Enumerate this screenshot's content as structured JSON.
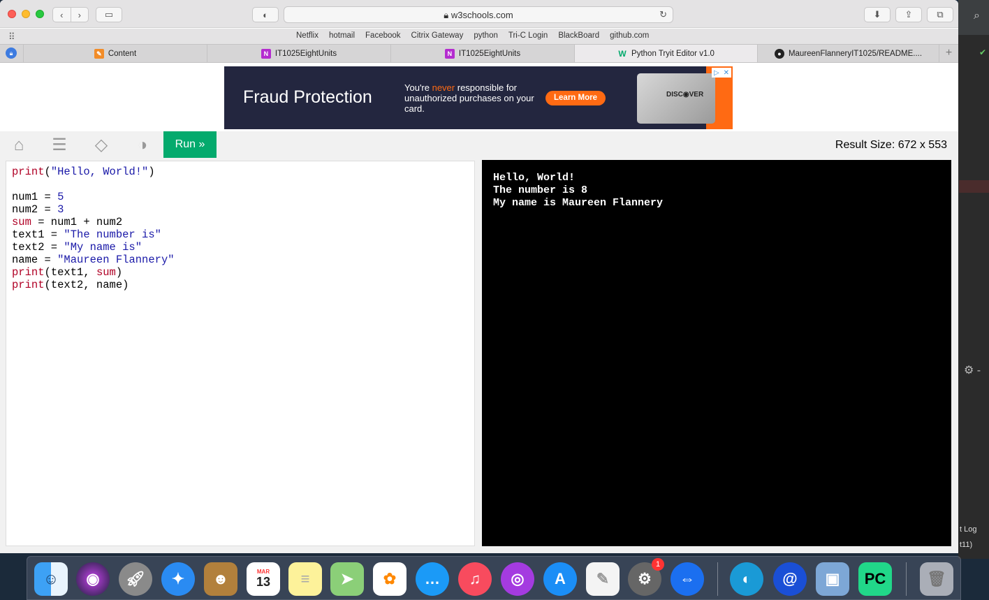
{
  "browser": {
    "url": "w3schools.com",
    "favorites": [
      "Netflix",
      "hotmail",
      "Facebook",
      "Citrix Gateway",
      "python",
      "Tri-C Login",
      "BlackBoard",
      "github.com"
    ],
    "tabs": [
      {
        "label": "Content",
        "icon": "content-icon"
      },
      {
        "label": "IT1025EightUnits",
        "icon": "onenote-icon"
      },
      {
        "label": "IT1025EightUnits",
        "icon": "onenote-icon"
      },
      {
        "label": "Python Tryit Editor v1.0",
        "icon": "w3schools-icon"
      },
      {
        "label": "MaureenFlanneryIT1025/README....",
        "icon": "github-icon"
      }
    ]
  },
  "ad": {
    "headline": "Fraud Protection",
    "body_1": "You're ",
    "body_never": "never",
    "body_2": " responsible for unauthorized purchases on your card.",
    "cta": "Learn More",
    "card_brand": "DISC◉VER"
  },
  "toolbar": {
    "run_label": "Run »",
    "result_size": "Result Size: 672 x 553"
  },
  "editor": {
    "lines": [
      "print(\"Hello, World!\")",
      "",
      "num1 = 5",
      "num2 = 3",
      "sum = num1 + num2",
      "text1 = \"The number is\"",
      "text2 = \"My name is\"",
      "name = \"Maureen Flannery\"",
      "print(text1, sum)",
      "print(text2, name)"
    ]
  },
  "output": {
    "lines": [
      "Hello, World!",
      "The number is 8",
      "My name is Maureen Flannery"
    ]
  },
  "ide": {
    "log_1": "t Log",
    "log_2": "t11)"
  },
  "dock": {
    "calendar_month": "MAR",
    "calendar_day": "13",
    "badge": "1"
  },
  "colors": {
    "run_green": "#04aa6d",
    "keyword": "#b00025",
    "string": "#1a19a8"
  }
}
